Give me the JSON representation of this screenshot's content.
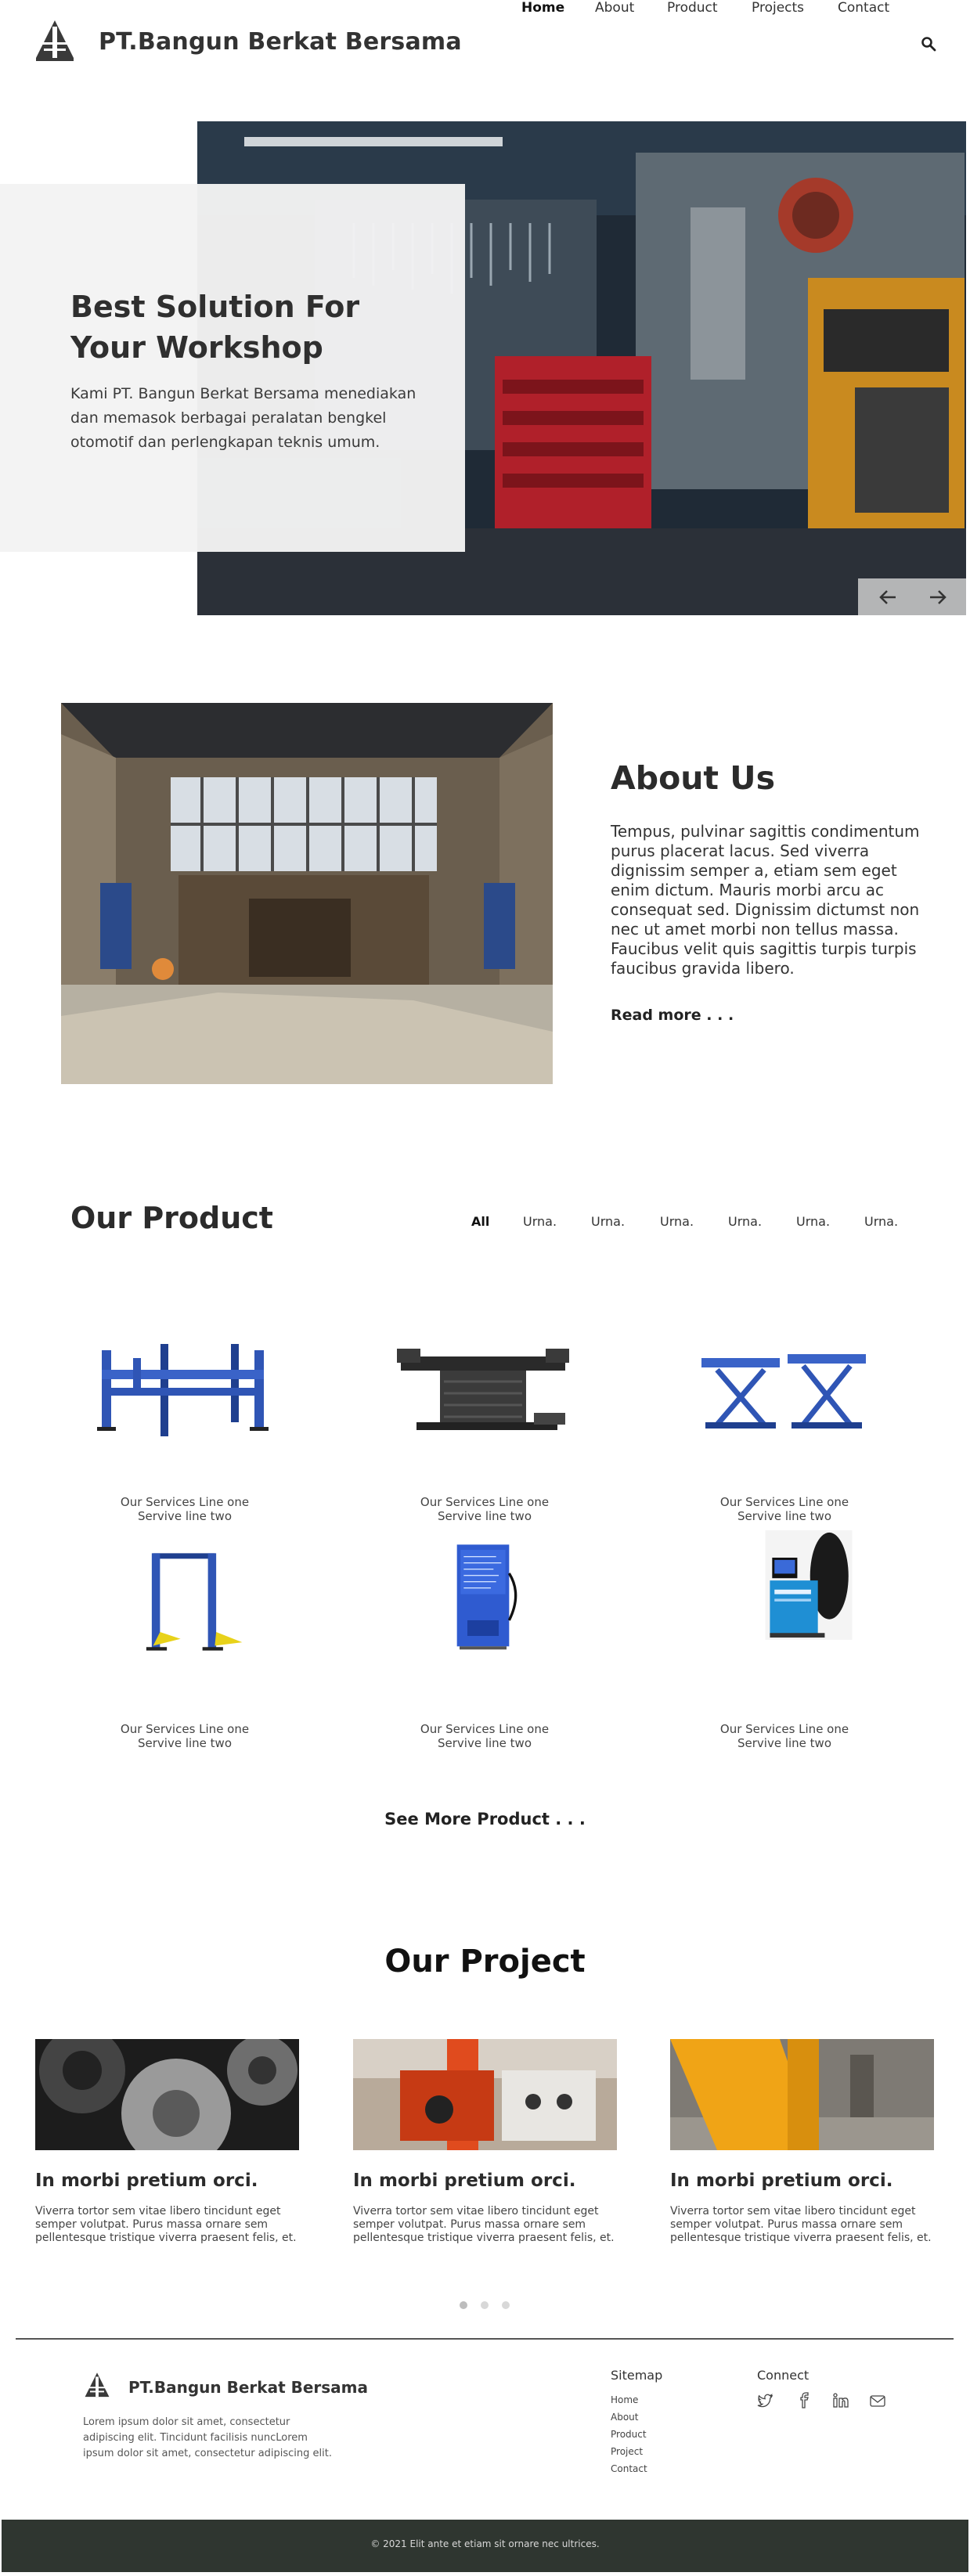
{
  "header": {
    "brand": "PT.Bangun Berkat Bersama",
    "nav": [
      "Home",
      "About",
      "Product",
      "Projects",
      "Contact"
    ],
    "active_nav": "Home"
  },
  "hero": {
    "title": "Best Solution For Your Workshop",
    "text": "Kami PT. Bangun Berkat Bersama menediakan dan memasok berbagai peralatan bengkel otomotif dan perlengkapan teknis umum."
  },
  "about": {
    "title": "About Us",
    "text": "Tempus, pulvinar sagittis condimentum purus placerat lacus. Sed viverra dignissim semper a, etiam sem eget enim dictum. Mauris morbi arcu ac consequat sed. Dignissim dictumst non nec ut amet morbi non tellus massa. Faucibus velit quis sagittis turpis turpis faucibus gravida libero.",
    "read_more": "Read more . . ."
  },
  "products": {
    "title": "Our Product",
    "filters": [
      "All",
      "Urna.",
      "Urna.",
      "Urna.",
      "Urna.",
      "Urna.",
      "Urna."
    ],
    "active_filter": "All",
    "items": [
      {
        "caption1": "Our Services Line one",
        "caption2": "Servive line two",
        "icon": "four-post-lift"
      },
      {
        "caption1": "Our Services Line one",
        "caption2": "Servive line two",
        "icon": "scissor-jack"
      },
      {
        "caption1": "Our Services Line one",
        "caption2": "Servive line two",
        "icon": "double-scissor-lift"
      },
      {
        "caption1": "Our Services Line one",
        "caption2": "Servive line two",
        "icon": "two-post-lift"
      },
      {
        "caption1": "Our Services Line one",
        "caption2": "Servive line two",
        "icon": "nitrogen-inflator"
      },
      {
        "caption1": "Our Services Line one",
        "caption2": "Servive line two",
        "icon": "wheel-balancer"
      }
    ],
    "see_more": "See More Product . . ."
  },
  "projects": {
    "title": "Our Project",
    "items": [
      {
        "title": "In morbi pretium orci.",
        "text": "Viverra tortor sem vitae libero tincidunt eget semper volutpat. Purus massa ornare sem pellentesque tristique viverra praesent felis, et."
      },
      {
        "title": "In morbi pretium orci.",
        "text": "Viverra tortor sem vitae libero tincidunt eget semper volutpat. Purus massa ornare sem pellentesque tristique viverra praesent felis, et."
      },
      {
        "title": "In morbi pretium orci.",
        "text": "Viverra tortor sem vitae libero tincidunt eget semper volutpat. Purus massa ornare sem pellentesque tristique viverra praesent felis, et."
      }
    ],
    "pager_active": 1
  },
  "footer": {
    "brand": "PT.Bangun Berkat Bersama",
    "desc": "Lorem ipsum dolor sit amet, consectetur adipiscing elit. Tincidunt facilisis nuncLorem ipsum dolor sit amet, consectetur adipiscing elit.",
    "sitemap_title": "Sitemap",
    "sitemap": [
      "Home",
      "About",
      "Product",
      "Project",
      "Contact"
    ],
    "connect_title": "Connect",
    "social": [
      "twitter-icon",
      "facebook-icon",
      "linkedin-icon",
      "mail-icon"
    ],
    "copyright": "© 2021 Elit ante et etiam sit ornare nec ultrices."
  },
  "colors": {
    "footer_bar": "#2f3630",
    "product_blue": "#2f55b5",
    "text_dark": "#2b2b2b"
  }
}
